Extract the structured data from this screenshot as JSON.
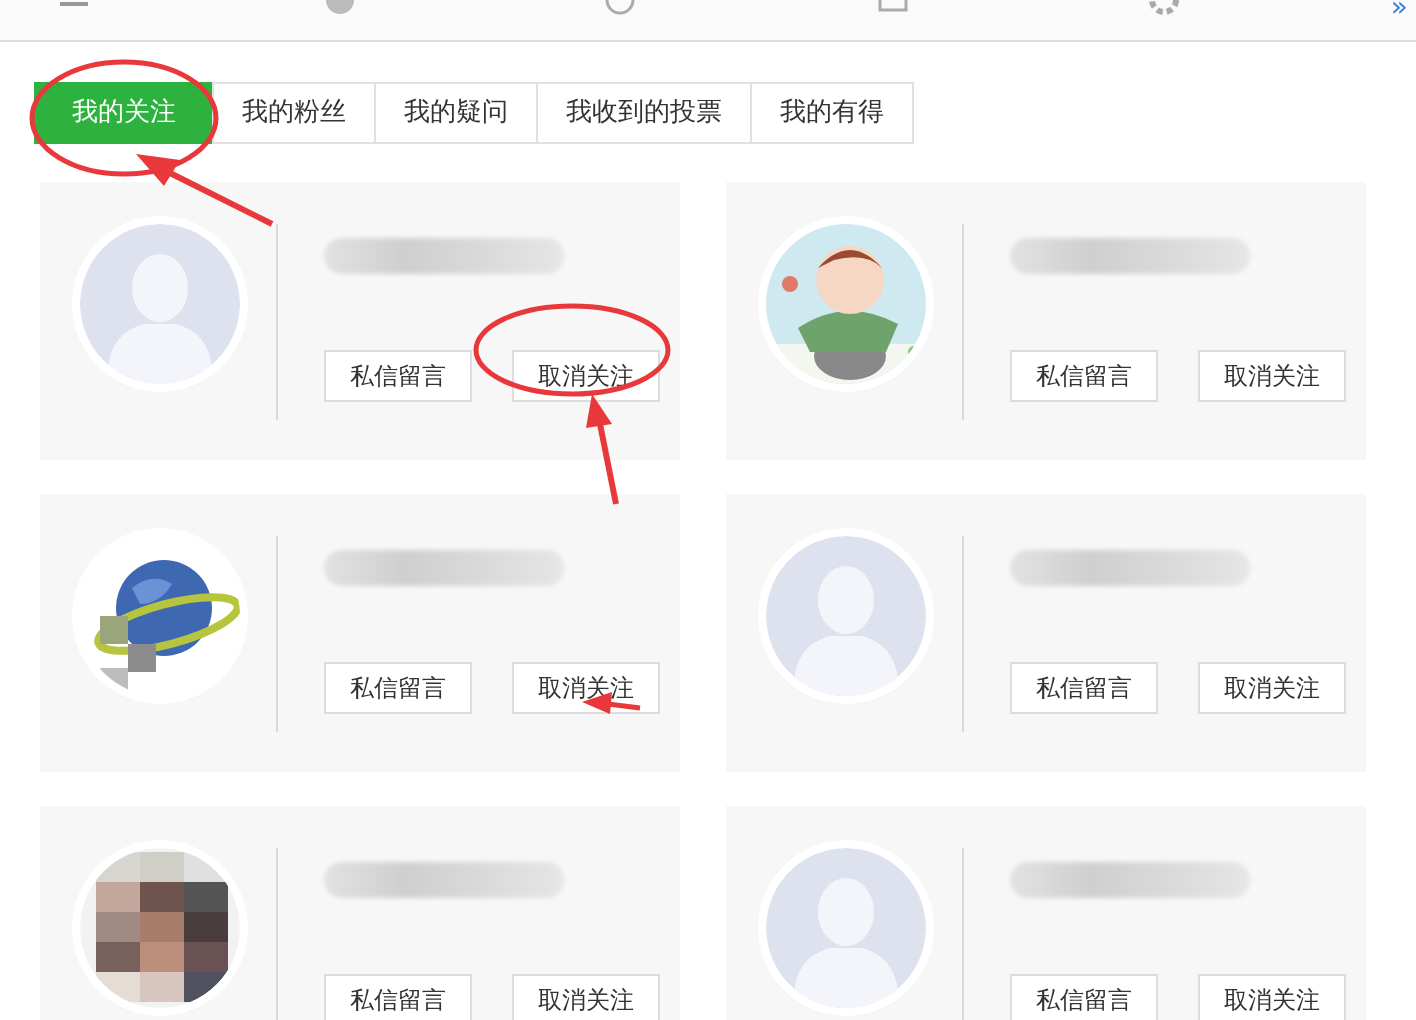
{
  "top_nav": {
    "more": "»"
  },
  "tabs": [
    {
      "label": "我的关注",
      "selected": true
    },
    {
      "label": "我的粉丝",
      "selected": false
    },
    {
      "label": "我的疑问",
      "selected": false
    },
    {
      "label": "我收到的投票",
      "selected": false
    },
    {
      "label": "我的有得",
      "selected": false
    }
  ],
  "users": [
    {
      "kind": "default",
      "buttons": [
        "私信留言",
        "取消关注"
      ]
    },
    {
      "kind": "picture",
      "buttons": [
        "私信留言",
        "取消关注"
      ]
    },
    {
      "kind": "picture",
      "buttons": [
        "私信留言",
        "取消关注"
      ]
    },
    {
      "kind": "default",
      "buttons": [
        "私信留言",
        "取消关注"
      ]
    },
    {
      "kind": "picture",
      "buttons": [
        "私信留言",
        "取消关注"
      ]
    },
    {
      "kind": "default",
      "buttons": [
        "私信留言",
        "取消关注"
      ]
    }
  ]
}
